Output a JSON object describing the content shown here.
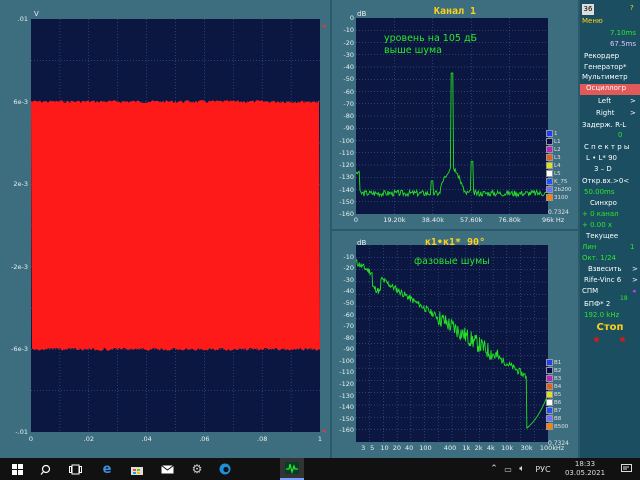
{
  "left": {
    "unit": "V",
    "y_ticks": [
      ".01",
      "6e-3",
      "2e-3",
      "-2e-3",
      "-6e-3",
      "-.01"
    ],
    "x_ticks": [
      "0",
      ".02",
      ".04",
      ".06",
      ".08",
      "1"
    ],
    "x_values": [
      0,
      0.02,
      0.04,
      0.06,
      0.08,
      0.1
    ],
    "y_values": [
      0.01,
      0.006,
      0.002,
      -0.002,
      -0.006,
      -0.01
    ],
    "signal_top": 0.006,
    "signal_bottom": -0.006
  },
  "spec1": {
    "title": "Канал 1",
    "unit": "dB",
    "annotation": [
      "уровень на 105 дБ",
      "выше шума"
    ],
    "y_ticks": [
      "0",
      "-10",
      "-20",
      "-30",
      "-40",
      "-50",
      "-60",
      "-70",
      "-80",
      "-90",
      "-100",
      "-110",
      "-120",
      "-130",
      "-140",
      "-150",
      "-160"
    ],
    "x_ticks": [
      "0",
      "19.20k",
      "38.40k",
      "57.60k",
      "76.80k",
      "96k",
      "Hz"
    ],
    "legend": [
      {
        "label": "1",
        "color": "#1e3cff"
      },
      {
        "label": "L1",
        "color": "#0a0a50"
      },
      {
        "label": "L2",
        "color": "#c020c0"
      },
      {
        "label": "L3",
        "color": "#e06020"
      },
      {
        "label": "L4",
        "color": "#e0e020"
      },
      {
        "label": "L5",
        "color": "#ffffff"
      },
      {
        "label": "K_75",
        "color": "#2050ff"
      },
      {
        "label": "2b200",
        "color": "#7070ff"
      },
      {
        "label": "3100",
        "color": "#ff8000"
      }
    ],
    "value": "0.7324"
  },
  "spec2": {
    "title": "к1•к1* 90°",
    "unit": "dB",
    "annotation": [
      "фазовые шумы"
    ],
    "y_ticks": [
      "-10",
      "-20",
      "-30",
      "-40",
      "-50",
      "-60",
      "-70",
      "-80",
      "-90",
      "-100",
      "-110",
      "-120",
      "-130",
      "-140",
      "-150",
      "-160"
    ],
    "x_ticks": [
      "3",
      "5",
      "10",
      "20",
      "40",
      "100",
      "400",
      "1k",
      "2k",
      "4k",
      "10k",
      "30k",
      "100k",
      "Hz"
    ],
    "legend": [
      {
        "label": "B1",
        "color": "#1e3cff"
      },
      {
        "label": "B2",
        "color": "#0a0a50"
      },
      {
        "label": "B3",
        "color": "#c020c0"
      },
      {
        "label": "B4",
        "color": "#e06020"
      },
      {
        "label": "B5",
        "color": "#e0e020"
      },
      {
        "label": "B6",
        "color": "#ffffff"
      },
      {
        "label": "B7",
        "color": "#2050ff"
      },
      {
        "label": "B8",
        "color": "#7070ff"
      },
      {
        "label": "B500",
        "color": "#ff8000"
      }
    ],
    "value": "0.7324"
  },
  "sidebar": {
    "logo": "36",
    "help": "?",
    "menu": "Меню",
    "v1": "7.10ms",
    "v2": "67.5ms",
    "record": "Рекордер",
    "generator": "Генератор*",
    "multimeter": "Мультиметр",
    "oscilloscope": "Осциллогр",
    "left": "Left",
    "right": "Right",
    "delay": "Задерж. R-L",
    "delay_val": "0",
    "spectra": "С п е к т р ы",
    "lr": "L • L* 90",
    "threed": "3 – D",
    "open_in": "Откр.вх.>0<",
    "val3": "50.00ms",
    "sync": "Синхро",
    "ch": "+ 0 канал",
    "val4": "+ 0.00 x",
    "current": "Текущее",
    "lin": "Лин",
    "lin_val": "1",
    "oct": "Окт. 1/24",
    "weigh": "Взвесить",
    "rife": "Rife-Vinc 6",
    "spm": "СПМ",
    "bpf": "БПФ* 2",
    "bpf_pow": "18",
    "freq": "192.0 kHz",
    "stop": "Стоп"
  },
  "taskbar": {
    "lang": "РУС",
    "time": "18:33",
    "date": "03.05.2021"
  }
}
